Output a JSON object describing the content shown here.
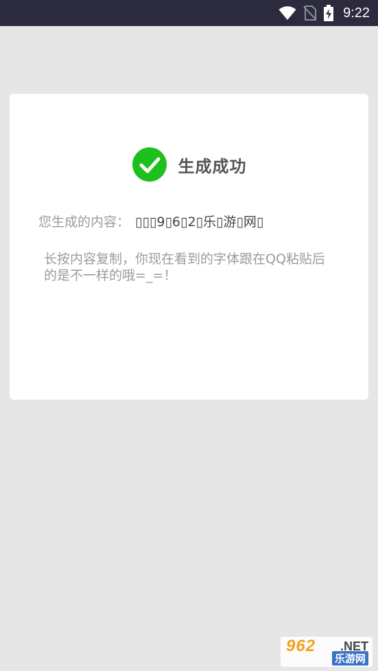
{
  "status_bar": {
    "time": "9:22",
    "icons": [
      "wifi-icon",
      "no-sim-icon",
      "battery-charging-icon"
    ]
  },
  "card": {
    "title": "生成成功",
    "result_label": "您生成的内容：",
    "result_value": "▯▯▯9▯6▯2▯乐▯游▯网▯",
    "hint": "长按内容复制，你现在看到的字体跟在QQ粘贴后的是不一样的哦=_=！"
  },
  "watermark": {
    "top": "962",
    "net": ".NET",
    "bottom": "乐游网"
  },
  "colors": {
    "status_bar_bg": "#2b2b3d",
    "page_bg": "#e6e6e6",
    "success_green": "#1fbf1f"
  }
}
